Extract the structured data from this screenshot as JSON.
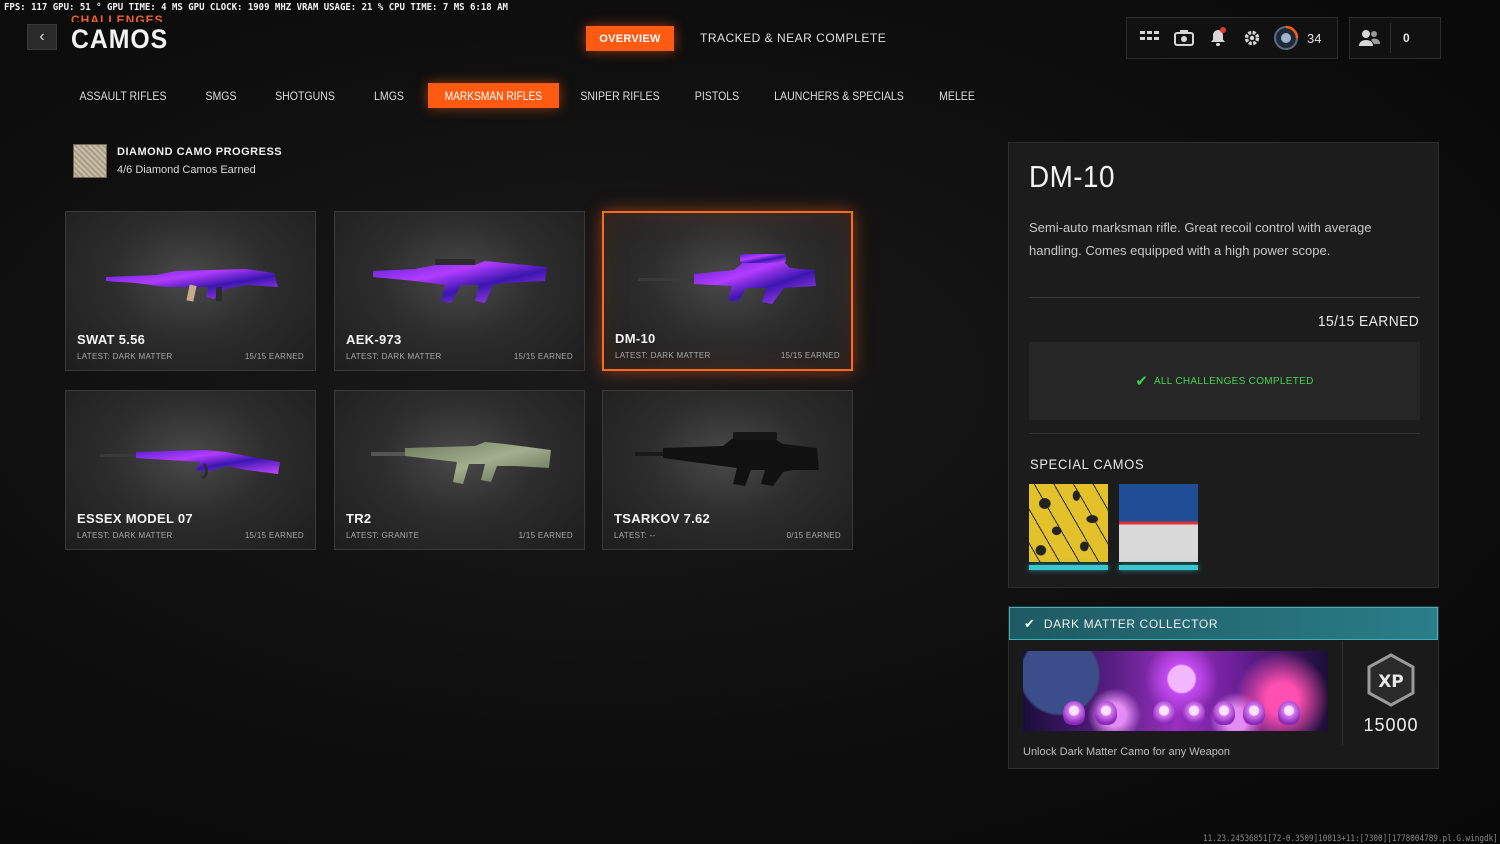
{
  "overlay": {
    "perf": "FPS: 117  GPU: 51 °  GPU TIME:  4 MS  GPU CLOCK: 1909 MHZ  VRAM USAGE: 21 %  CPU TIME:  7 MS  6:18 AM",
    "build": "11.23.24536851[72-0.3509]10813+11:[7300][1778004789.pl.G.wingdk]"
  },
  "header": {
    "back_glyph": "‹",
    "subtitle": "CHALLENGES",
    "title": "CAMOS",
    "tabs": [
      {
        "label": "OVERVIEW",
        "active": true
      },
      {
        "label": "TRACKED & NEAR COMPLETE",
        "active": false
      }
    ],
    "icons": [
      "grid-icon",
      "camera-icon",
      "bell-icon",
      "gear-icon",
      "prestige-emblem-icon"
    ],
    "level": "34",
    "friends_count": "0",
    "accent": "#ff5a12",
    "notification_dot": "#e6392b"
  },
  "categories": [
    {
      "label": "ASSAULT RIFLES",
      "active": false
    },
    {
      "label": "SMGS",
      "active": false
    },
    {
      "label": "SHOTGUNS",
      "active": false
    },
    {
      "label": "LMGS",
      "active": false
    },
    {
      "label": "MARKSMAN RIFLES",
      "active": true
    },
    {
      "label": "SNIPER RIFLES",
      "active": false
    },
    {
      "label": "PISTOLS",
      "active": false
    },
    {
      "label": "LAUNCHERS & SPECIALS",
      "active": false
    },
    {
      "label": "MELEE",
      "active": false
    }
  ],
  "diamond": {
    "title": "DIAMOND CAMO PROGRESS",
    "subtitle": "4/6 Diamond Camos Earned",
    "earned": 4,
    "total": 6
  },
  "weapons": [
    {
      "name": "SWAT 5.56",
      "latest": "LATEST: DARK MATTER",
      "earned": "15/15 EARNED",
      "camo": "dark-matter",
      "selected": false
    },
    {
      "name": "AEK-973",
      "latest": "LATEST: DARK MATTER",
      "earned": "15/15 EARNED",
      "camo": "dark-matter",
      "selected": false
    },
    {
      "name": "DM-10",
      "latest": "LATEST: DARK MATTER",
      "earned": "15/15 EARNED",
      "camo": "dark-matter",
      "selected": true
    },
    {
      "name": "ESSEX MODEL 07",
      "latest": "LATEST: DARK MATTER",
      "earned": "15/15 EARNED",
      "camo": "dark-matter",
      "selected": false
    },
    {
      "name": "TR2",
      "latest": "LATEST: GRANITE",
      "earned": "1/15 EARNED",
      "camo": "granite",
      "selected": false
    },
    {
      "name": "TSARKOV 7.62",
      "latest": "LATEST: --",
      "earned": "0/15 EARNED",
      "camo": "none",
      "selected": false
    }
  ],
  "detail": {
    "name": "DM-10",
    "description": "Semi-auto marksman rifle. Great recoil control with average handling. Comes equipped with a high power scope.",
    "earned": "15/15 EARNED",
    "challenges_status": "ALL CHALLENGES COMPLETED",
    "special_camos_title": "SPECIAL CAMOS",
    "special_camos": [
      "yellow-vine-camo",
      "blue-white-camo"
    ]
  },
  "mission": {
    "title": "DARK MATTER COLLECTOR",
    "xp": "15000",
    "description": "Unlock Dark Matter Camo for any Weapon",
    "completed": true
  }
}
